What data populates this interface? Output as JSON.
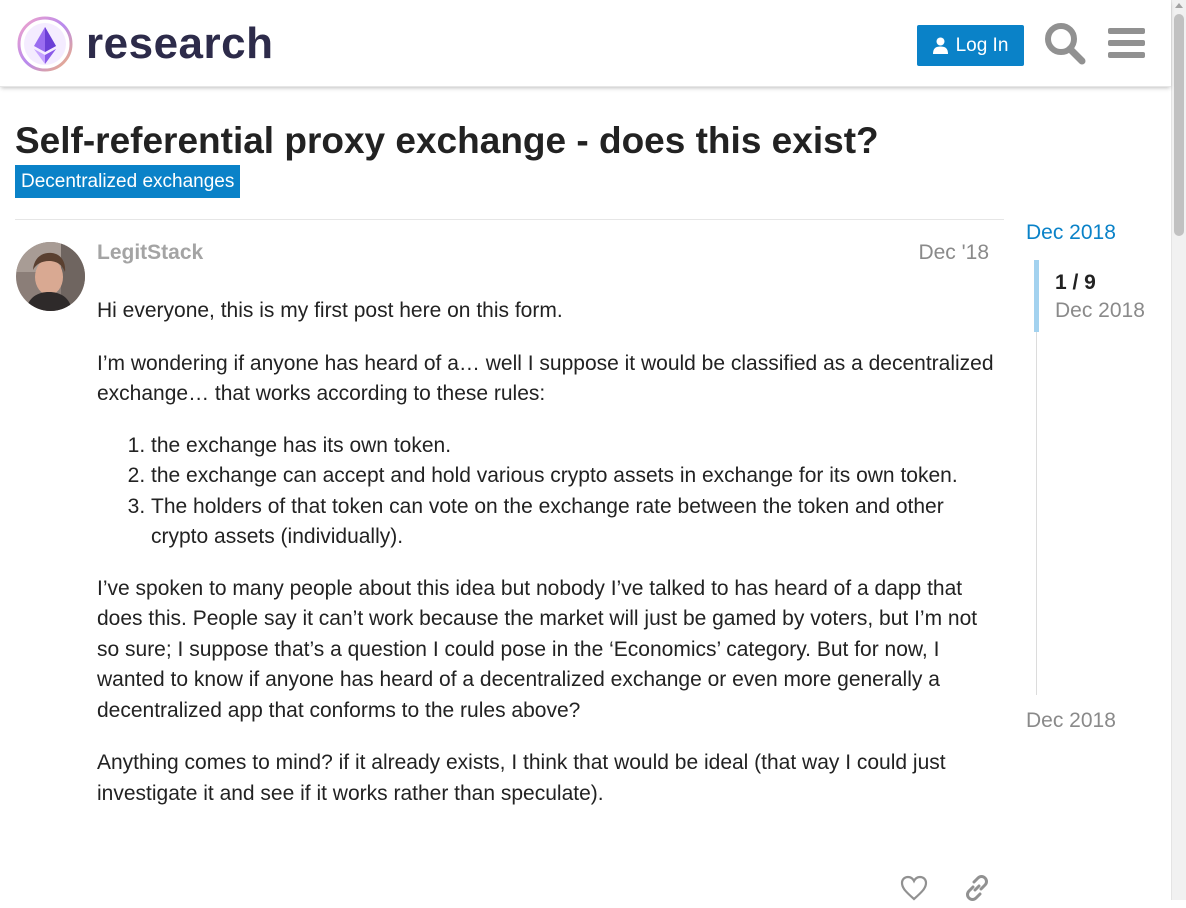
{
  "header": {
    "site_name": "research",
    "login_label": "Log In"
  },
  "topic": {
    "title": "Self-referential proxy exchange - does this exist?",
    "category": "Decentralized exchanges"
  },
  "post": {
    "username": "LegitStack",
    "date": "Dec '18",
    "paragraphs": [
      "Hi everyone, this is my first post here on this form.",
      "I’m wondering if anyone has heard of a… well I suppose it would be classified as a decentralized exchange… that works according to these rules:",
      "I’ve spoken to many people about this idea but nobody I’ve talked to has heard of a dapp that does this. People say it can’t work because the market will just be gamed by voters, but I’m not so sure; I suppose that’s a question I could pose in the ‘Economics’ category. But for now, I wanted to know if anyone has heard of a decentralized exchange or even more generally a decentralized app that conforms to the rules above?",
      "Anything comes to mind? if it already exists, I think that would be ideal (that way I could just investigate it and see if it works rather than speculate)."
    ],
    "rules": [
      "the exchange has its own token.",
      "the exchange can accept and hold various crypto assets in exchange for its own token.",
      "The holders of that token can vote on the exchange rate between the token and other crypto assets (individually)."
    ]
  },
  "timeline": {
    "start_date": "Dec 2018",
    "position": "1 / 9",
    "current_date": "Dec 2018",
    "end_date": "Dec 2018"
  },
  "colors": {
    "accent": "#0a82c8",
    "muted": "#8a8a8a",
    "timeline_handle": "#a3d2ef"
  }
}
